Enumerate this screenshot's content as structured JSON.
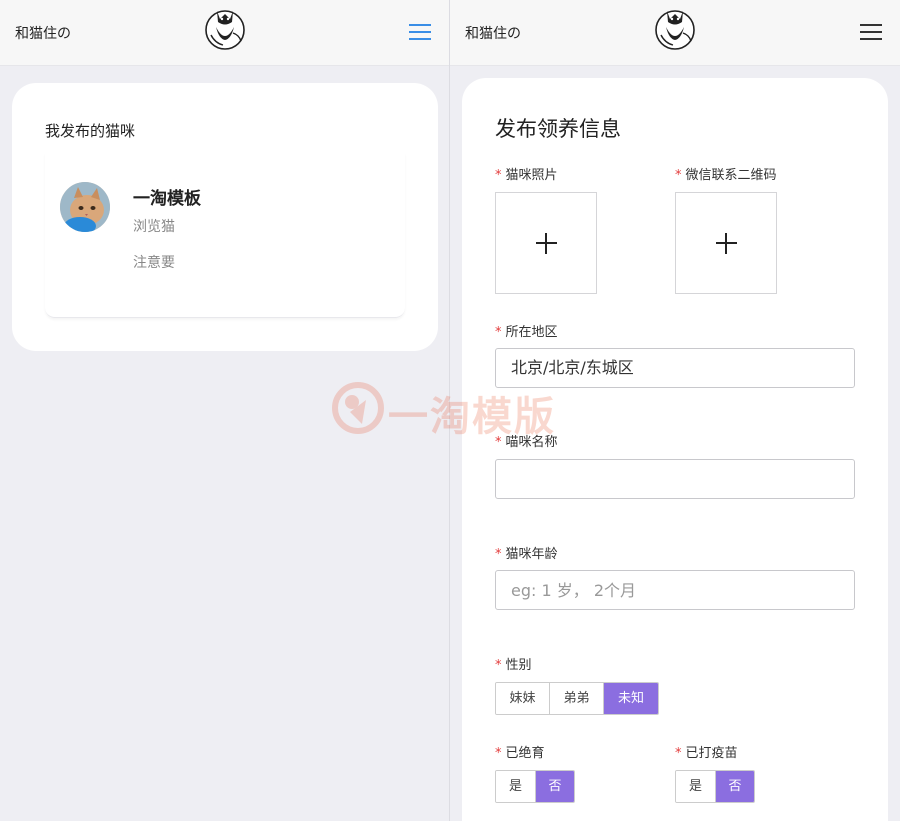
{
  "left": {
    "header": {
      "brand": "和猫住の",
      "menu_icon": "hamburger-menu-icon",
      "menu_color": "#3a8ee6"
    },
    "section_title": "我发布的猫咪",
    "cat": {
      "name": "一淘模板",
      "meta1": "浏览猫",
      "meta2": "注意要"
    }
  },
  "right": {
    "header": {
      "brand": "和猫住の",
      "menu_icon": "hamburger-menu-icon",
      "menu_color": "#333333"
    },
    "form": {
      "title": "发布领养信息",
      "required_mark": "*",
      "photo_label": "猫咪照片",
      "qr_label": "微信联系二维码",
      "region_label": "所在地区",
      "region_value": "北京/北京/东城区",
      "name_label": "喵咪名称",
      "name_value": "",
      "age_label": "猫咪年龄",
      "age_placeholder": "eg: 1 岁， 2个月",
      "gender_label": "性别",
      "gender_options": [
        "妹妹",
        "弟弟",
        "未知"
      ],
      "gender_selected": "未知",
      "neutered_label": "已绝育",
      "neutered_options": [
        "是",
        "否"
      ],
      "neutered_selected": "否",
      "vaccinated_label": "已打疫苗",
      "vaccinated_options": [
        "是",
        "否"
      ],
      "vaccinated_selected": "否"
    }
  },
  "watermark": {
    "text": "一淘模版",
    "color": "#e8502a"
  },
  "accent_color": "#8b6ee0"
}
